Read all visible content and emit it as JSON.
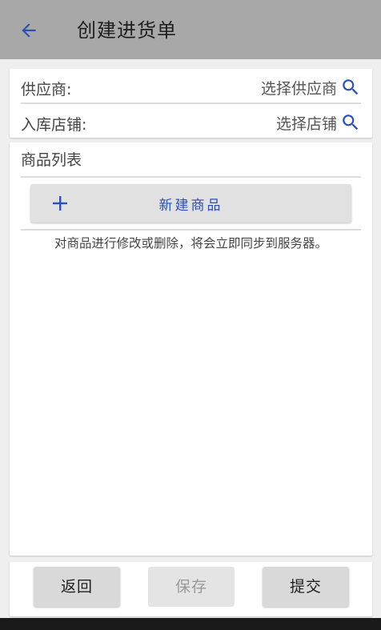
{
  "header": {
    "title": "创建进货单",
    "back_icon": "arrow-left-icon"
  },
  "form": {
    "supplier": {
      "label": "供应商:",
      "value": "选择供应商"
    },
    "store": {
      "label": "入库店铺:",
      "value": "选择店铺"
    }
  },
  "product_list": {
    "title": "商品列表",
    "new_button_label": "新建商品",
    "hint": "对商品进行修改或删除，将会立即同步到服务器。"
  },
  "actions": {
    "back_label": "返回",
    "save_label": "保存",
    "submit_label": "提交"
  },
  "colors": {
    "accent": "#2c4fb8",
    "header_bg": "#a8a8a8",
    "page_bg": "#efefef"
  }
}
